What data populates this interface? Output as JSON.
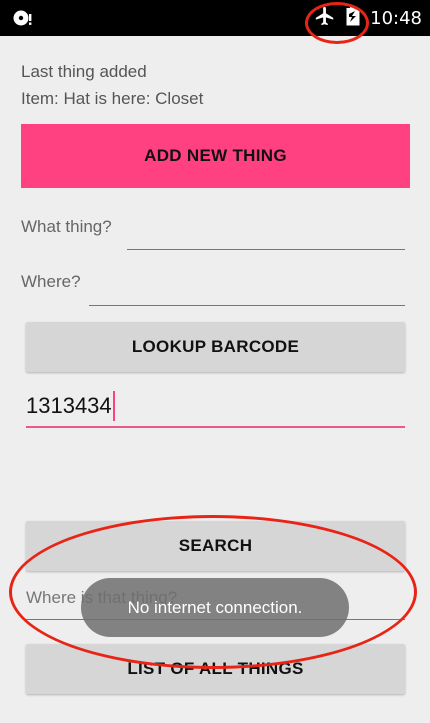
{
  "status_bar": {
    "time": "10:48",
    "icons": [
      "notification-icon",
      "airplane-mode-icon",
      "battery-icon"
    ]
  },
  "last_added": {
    "heading": "Last thing added",
    "detail": "Item: Hat is here: Closet"
  },
  "add_button": {
    "label": "ADD NEW THING"
  },
  "what_field": {
    "label": "What thing?",
    "value": ""
  },
  "where_field": {
    "label": "Where?",
    "value": ""
  },
  "lookup_button": {
    "label": "LOOKUP BARCODE"
  },
  "barcode_input": {
    "value": "1313434"
  },
  "search_button": {
    "label": "SEARCH"
  },
  "where_search_field": {
    "placeholder": "Where is that thing?"
  },
  "list_button": {
    "label": "LIST OF ALL THINGS"
  },
  "toast": {
    "message": "No internet connection."
  },
  "colors": {
    "accent": "#ff4081",
    "annotation": "#e82417",
    "status_bar": "#000000",
    "background": "#eeeeee"
  }
}
